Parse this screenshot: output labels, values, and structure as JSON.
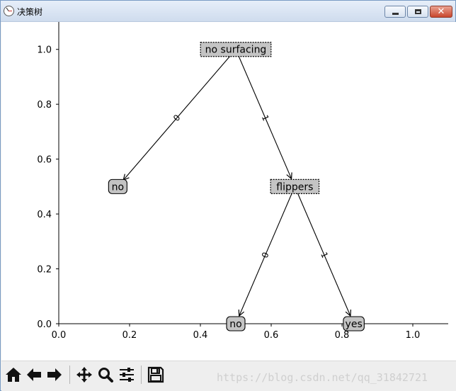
{
  "window": {
    "title": "决策树",
    "minimize_label": "–",
    "maximize_label": "□",
    "close_label": "✕"
  },
  "chart_data": {
    "type": "tree",
    "xlim": [
      0.0,
      1.1
    ],
    "ylim": [
      0.0,
      1.1
    ],
    "x_ticks": [
      0.0,
      0.2,
      0.4,
      0.6,
      0.8,
      1.0
    ],
    "y_ticks": [
      0.0,
      0.2,
      0.4,
      0.6,
      0.8,
      1.0
    ],
    "x_tick_labels": [
      "0.0",
      "0.2",
      "0.4",
      "0.6",
      "0.8",
      "1.0"
    ],
    "y_tick_labels": [
      "0.0",
      "0.2",
      "0.4",
      "0.6",
      "0.8",
      "1.0"
    ],
    "nodes": [
      {
        "id": "no-surfacing",
        "label": "no surfacing",
        "x": 0.5,
        "y": 1.0,
        "kind": "decision"
      },
      {
        "id": "no-1",
        "label": "no",
        "x": 0.1667,
        "y": 0.5,
        "kind": "leaf"
      },
      {
        "id": "flippers",
        "label": "flippers",
        "x": 0.6667,
        "y": 0.5,
        "kind": "decision"
      },
      {
        "id": "no-2",
        "label": "no",
        "x": 0.5,
        "y": 0.0,
        "kind": "leaf"
      },
      {
        "id": "yes",
        "label": "yes",
        "x": 0.8333,
        "y": 0.0,
        "kind": "leaf"
      }
    ],
    "edges": [
      {
        "from": "no-surfacing",
        "to": "no-1",
        "label": "0"
      },
      {
        "from": "no-surfacing",
        "to": "flippers",
        "label": "1"
      },
      {
        "from": "flippers",
        "to": "no-2",
        "label": "0"
      },
      {
        "from": "flippers",
        "to": "yes",
        "label": "1"
      }
    ]
  },
  "toolbar": {
    "buttons": [
      {
        "name": "home-button",
        "icon": "home-icon"
      },
      {
        "name": "back-button",
        "icon": "arrow-left-icon"
      },
      {
        "name": "forward-button",
        "icon": "arrow-right-icon"
      },
      {
        "name": "pan-button",
        "icon": "move-icon"
      },
      {
        "name": "zoom-button",
        "icon": "magnifier-icon"
      },
      {
        "name": "configure-subplots-button",
        "icon": "sliders-icon"
      },
      {
        "name": "save-button",
        "icon": "floppy-disk-icon"
      }
    ]
  },
  "watermark": "https://blog.csdn.net/qq_31842721"
}
